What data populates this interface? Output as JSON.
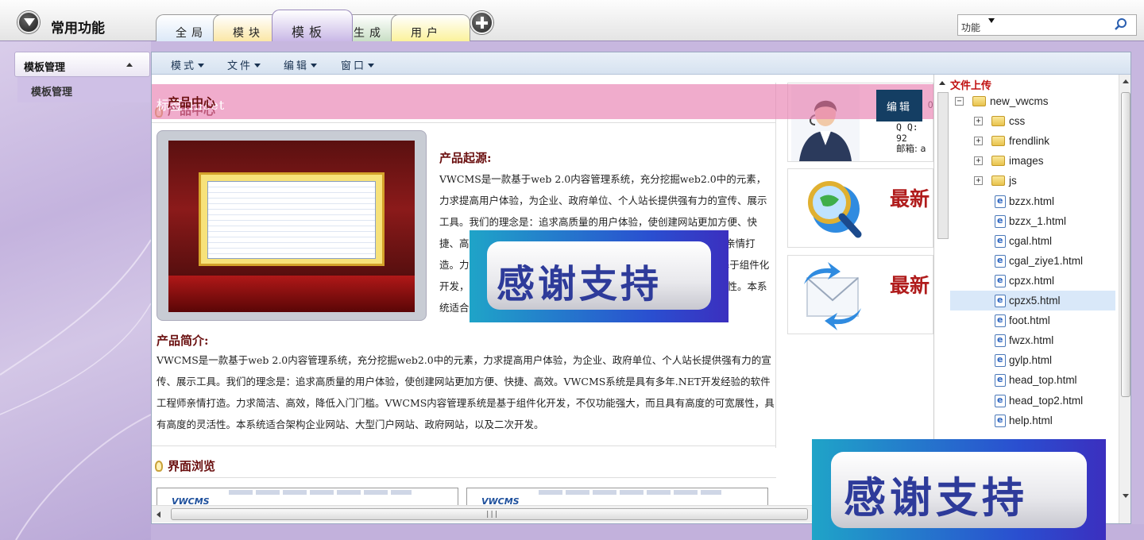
{
  "topbar": {
    "title": "常用功能",
    "tabs": [
      {
        "label": "全局",
        "color": "#dce9f8"
      },
      {
        "label": "模块",
        "color": "#fbe7a6"
      },
      {
        "label": "模板",
        "color": "#c9b8e6",
        "active": true
      },
      {
        "label": "生成",
        "color": "#c9dfc5"
      },
      {
        "label": "用户",
        "color": "#fbf29b"
      }
    ],
    "search": {
      "text": "功能"
    }
  },
  "sidebar": {
    "header": "模板管理",
    "items": [
      {
        "label": "模板管理"
      }
    ]
  },
  "menubar": {
    "items": [
      {
        "label": "模式"
      },
      {
        "label": "文件"
      },
      {
        "label": "编辑"
      },
      {
        "label": "窗口"
      }
    ]
  },
  "editor": {
    "inset_label": "标签:Inset",
    "edit_button": "编辑",
    "product_center_title": "产品中心",
    "origin_title": "产品起源:",
    "origin_text": "VWCMS是一款基于web 2.0内容管理系统，充分挖掘web2.0中的元素，力求提高用户体验，为企业、政府单位、个人站长提供强有力的宣传、展示工具。我们的理念是：追求高质量的用户体验，使创建网站更加方便、快捷、高效。VWCMS系统是具有多年.NET开发经验的软件工程师亲情打造。力求简洁、高效，降低入门门槛。VWCMS内容管理系统是基于组件化开发，不仅功能强大，而且具有高度的可宽展性，具有高度的灵活性。本系统适合架构企业网站、大型门户网站、政府网站，以及二次开发。",
    "intro_title": "产品简介:",
    "intro_text": "VWCMS是一款基于web 2.0内容管理系统，充分挖掘web2.0中的元素，力求提高用户体验，为企业、政府单位、个人站长提供强有力的宣传、展示工具。我们的理念是：追求高质量的用户体验，使创建网站更加方便、快捷、高效。VWCMS系统是具有多年.NET开发经验的软件工程师亲情打造。力求简洁、高效，降低入门门槛。VWCMS内容管理系统是基于组件化开发，不仅功能强大，而且具有高度的可宽展性，具有高度的灵活性。本系统适合架构企业网站、大型门户网站、政府网站，以及二次开发。",
    "browse_title": "界面浏览",
    "thumb_logo": "VWCMS",
    "contact": {
      "phone_fragment": "0",
      "qq": "Q Q: 92",
      "email": "邮箱: a"
    },
    "news": [
      {
        "label": "最新"
      },
      {
        "label": "最新"
      }
    ],
    "hscroll_grip": "|||"
  },
  "filetree": {
    "title": "文件上传",
    "items": [
      {
        "label": "new_vwcms",
        "type": "folder",
        "expander": "−",
        "indent": 0
      },
      {
        "label": "css",
        "type": "folder",
        "expander": "+",
        "indent": 1
      },
      {
        "label": "frendlink",
        "type": "folder",
        "expander": "+",
        "indent": 1
      },
      {
        "label": "images",
        "type": "folder",
        "expander": "+",
        "indent": 1
      },
      {
        "label": "js",
        "type": "folder",
        "expander": "+",
        "indent": 1
      },
      {
        "label": "bzzx.html",
        "type": "file",
        "indent": 1
      },
      {
        "label": "bzzx_1.html",
        "type": "file",
        "indent": 1
      },
      {
        "label": "cgal.html",
        "type": "file",
        "indent": 1
      },
      {
        "label": "cgal_ziye1.html",
        "type": "file",
        "indent": 1
      },
      {
        "label": "cpzx.html",
        "type": "file",
        "indent": 1
      },
      {
        "label": "cpzx5.html",
        "type": "file",
        "indent": 1,
        "selected": true
      },
      {
        "label": "foot.html",
        "type": "file",
        "indent": 1
      },
      {
        "label": "fwzx.html",
        "type": "file",
        "indent": 1
      },
      {
        "label": "gylp.html",
        "type": "file",
        "indent": 1
      },
      {
        "label": "head_top.html",
        "type": "file",
        "indent": 1
      },
      {
        "label": "head_top2.html",
        "type": "file",
        "indent": 1
      },
      {
        "label": "help.html",
        "type": "file",
        "indent": 1
      }
    ]
  },
  "watermarks": [
    {
      "text": "感谢支持"
    },
    {
      "text": "感谢支持"
    }
  ]
}
